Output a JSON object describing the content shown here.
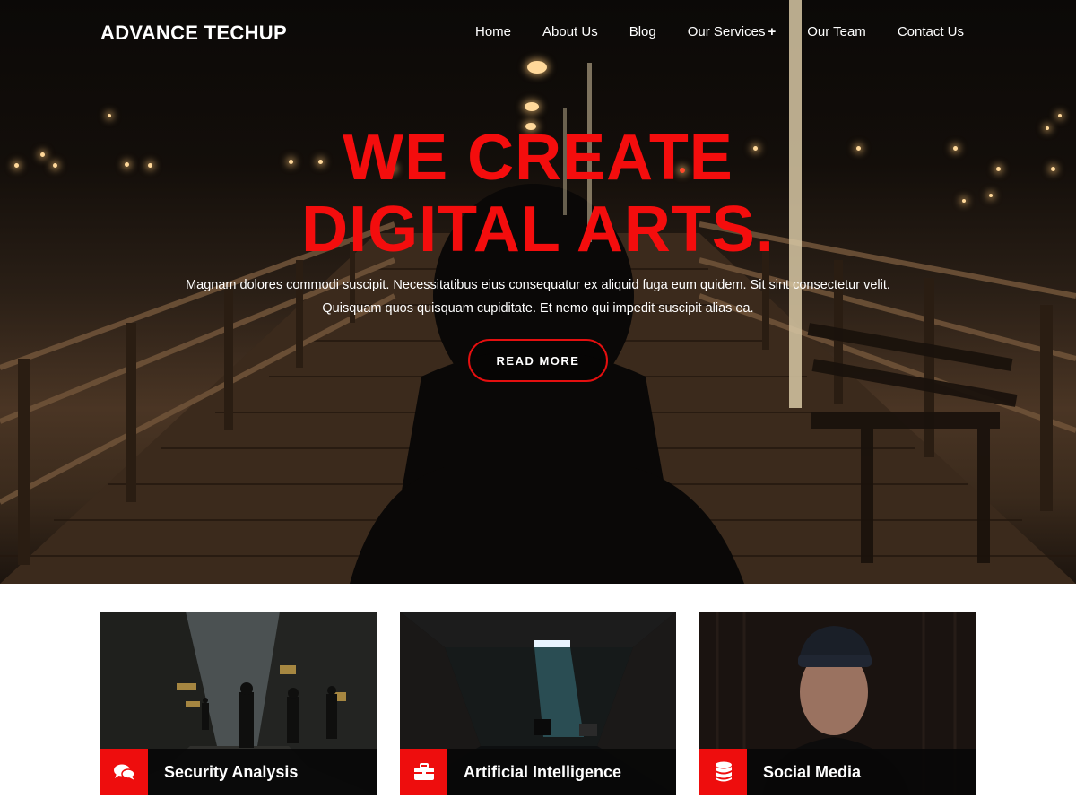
{
  "brand": {
    "name": "ADVANCE TECHUP"
  },
  "nav": {
    "items": [
      {
        "label": "Home"
      },
      {
        "label": "About Us"
      },
      {
        "label": "Blog"
      },
      {
        "label": "Our Services",
        "has_submenu": true,
        "submenu_marker": "+"
      },
      {
        "label": "Our Team"
      },
      {
        "label": "Contact Us"
      }
    ]
  },
  "hero": {
    "title_line1": "WE CREATE",
    "title_line2": "DIGITAL ARTS.",
    "subtitle_line1": "Magnam dolores commodi suscipit. Necessitatibus eius consequatur ex aliquid fuga eum quidem. Sit sint consectetur velit.",
    "subtitle_line2": "Quisquam quos quisquam cupiditate. Et nemo qui impedit suscipit alias ea.",
    "button_label": "READ MORE"
  },
  "cards": [
    {
      "title": "Security Analysis",
      "icon": "comments-icon"
    },
    {
      "title": "Artificial Intelligence",
      "icon": "briefcase-icon"
    },
    {
      "title": "Social Media",
      "icon": "database-icon"
    }
  ],
  "colors": {
    "accent": "#ee0d0d",
    "hero_title": "#f40d0d",
    "caption_bg": "#080808",
    "text": "#ffffff"
  }
}
